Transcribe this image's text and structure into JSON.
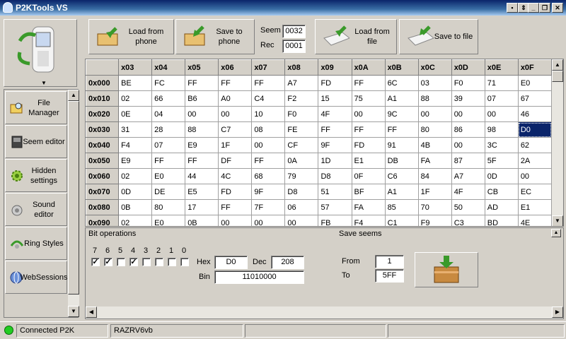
{
  "window": {
    "title": "P2KTools VS"
  },
  "nav": {
    "items": [
      {
        "label": "File Manager",
        "icon": "folder-magnifier-icon"
      },
      {
        "label": "Seem editor",
        "icon": "phone-dark-icon"
      },
      {
        "label": "Hidden settings",
        "icon": "gear-green-icon"
      },
      {
        "label": "Sound editor",
        "icon": "speaker-icon"
      },
      {
        "label": "Ring Styles",
        "icon": "ring-styles-icon"
      },
      {
        "label": "WebSessions",
        "icon": "globe-icon"
      }
    ]
  },
  "toolbar": {
    "load_phone": "Load from phone",
    "save_phone": "Save to phone",
    "seem_label": "Seem",
    "seem_value": "0032",
    "rec_label": "Rec",
    "rec_value": "0001",
    "load_file": "Load from file",
    "save_file": "Save to file"
  },
  "grid": {
    "columns": [
      "x03",
      "x04",
      "x05",
      "x06",
      "x07",
      "x08",
      "x09",
      "x0A",
      "x0B",
      "x0C",
      "x0D",
      "x0E",
      "x0F"
    ],
    "rows": [
      {
        "h": "0x000",
        "c": [
          "BE",
          "FC",
          "FF",
          "FF",
          "FF",
          "A7",
          "FD",
          "FF",
          "6C",
          "03",
          "F0",
          "71",
          "E0"
        ]
      },
      {
        "h": "0x010",
        "c": [
          "02",
          "66",
          "B6",
          "A0",
          "C4",
          "F2",
          "15",
          "75",
          "A1",
          "88",
          "39",
          "07",
          "67"
        ]
      },
      {
        "h": "0x020",
        "c": [
          "0E",
          "04",
          "00",
          "00",
          "10",
          "F0",
          "4F",
          "00",
          "9C",
          "00",
          "00",
          "00",
          "46"
        ]
      },
      {
        "h": "0x030",
        "c": [
          "31",
          "28",
          "88",
          "C7",
          "08",
          "FE",
          "FF",
          "FF",
          "FF",
          "80",
          "86",
          "98",
          "D0"
        ]
      },
      {
        "h": "0x040",
        "c": [
          "F4",
          "07",
          "E9",
          "1F",
          "00",
          "CF",
          "9F",
          "FD",
          "91",
          "4B",
          "00",
          "3C",
          "62"
        ]
      },
      {
        "h": "0x050",
        "c": [
          "E9",
          "FF",
          "FF",
          "DF",
          "FF",
          "0A",
          "1D",
          "E1",
          "DB",
          "FA",
          "87",
          "5F",
          "2A"
        ]
      },
      {
        "h": "0x060",
        "c": [
          "02",
          "E0",
          "44",
          "4C",
          "68",
          "79",
          "D8",
          "0F",
          "C6",
          "84",
          "A7",
          "0D",
          "00"
        ]
      },
      {
        "h": "0x070",
        "c": [
          "0D",
          "DE",
          "E5",
          "FD",
          "9F",
          "D8",
          "51",
          "BF",
          "A1",
          "1F",
          "4F",
          "CB",
          "EC"
        ]
      },
      {
        "h": "0x080",
        "c": [
          "0B",
          "80",
          "17",
          "FF",
          "7F",
          "06",
          "57",
          "FA",
          "85",
          "70",
          "50",
          "AD",
          "E1"
        ]
      },
      {
        "h": "0x090",
        "c": [
          "02",
          "E0",
          "0B",
          "00",
          "00",
          "00",
          "FB",
          "F4",
          "C1",
          "F9",
          "C3",
          "BD",
          "4E"
        ]
      }
    ],
    "selected": {
      "row": 3,
      "col": 12
    }
  },
  "bitops": {
    "title": "Bit operations",
    "save_title": "Save seems",
    "bits": [
      {
        "label": "7",
        "checked": true
      },
      {
        "label": "6",
        "checked": true
      },
      {
        "label": "5",
        "checked": false
      },
      {
        "label": "4",
        "checked": true
      },
      {
        "label": "3",
        "checked": false
      },
      {
        "label": "2",
        "checked": false
      },
      {
        "label": "1",
        "checked": false
      },
      {
        "label": "0",
        "checked": false
      }
    ],
    "hex_label": "Hex",
    "hex_value": "D0",
    "dec_label": "Dec",
    "dec_value": "208",
    "bin_label": "Bin",
    "bin_value": "11010000",
    "from_label": "From",
    "from_value": "1",
    "to_label": "To",
    "to_value": "5FF"
  },
  "status": {
    "connection": "Connected P2K",
    "model": "RAZRV6vb"
  },
  "colors": {
    "selection": "#0a246a",
    "connected": "#22cc22"
  }
}
